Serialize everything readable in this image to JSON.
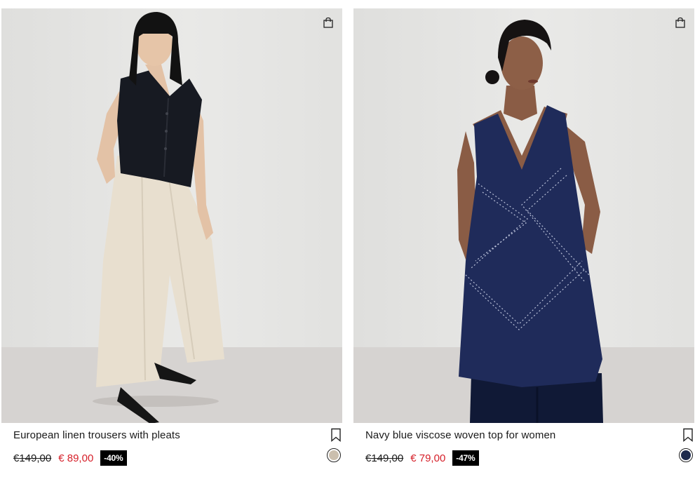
{
  "products": [
    {
      "title": "European linen trousers with pleats",
      "old_price": "€149,00",
      "new_price": "€ 89,00",
      "discount": "-40%",
      "swatch_color": "#cbbfae",
      "icons": {
        "bag": "shopping-bag-icon",
        "save": "bookmark-icon"
      }
    },
    {
      "title": "Navy blue viscose woven top for women",
      "old_price": "€149,00",
      "new_price": "€ 79,00",
      "discount": "-47%",
      "swatch_color": "#1d2a4d",
      "icons": {
        "bag": "shopping-bag-icon",
        "save": "bookmark-icon"
      }
    }
  ],
  "colors": {
    "sale_price": "#d6202a",
    "discount_badge_bg": "#000000",
    "text": "#1a1a1a"
  }
}
